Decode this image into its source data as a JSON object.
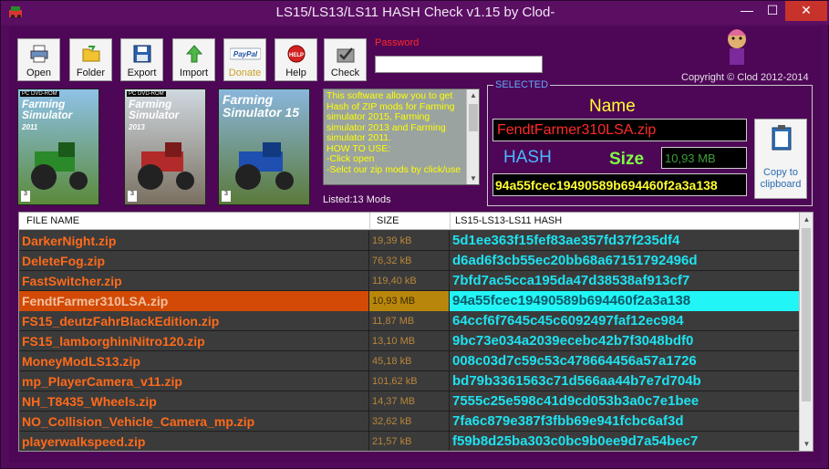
{
  "window": {
    "title": "LS15/LS13/LS11 HASH Check v1.15 by Clod-",
    "minimize_glyph": "—",
    "maximize_glyph": "☐",
    "close_glyph": "✕"
  },
  "toolbar": {
    "buttons": [
      {
        "label": "Open",
        "icon": "printer-icon"
      },
      {
        "label": "Folder",
        "icon": "folder-icon"
      },
      {
        "label": "Export",
        "icon": "floppy-icon"
      },
      {
        "label": "Import",
        "icon": "import-arrow-icon"
      },
      {
        "label": "Donate",
        "icon": "paypal-icon"
      },
      {
        "label": "Help",
        "icon": "help-icon"
      },
      {
        "label": "Check",
        "icon": "check-icon"
      }
    ],
    "paypal_text": "PayPal",
    "help_text": "HELP"
  },
  "password": {
    "label": "Password",
    "value": ""
  },
  "copyright": "Copyright © Clod 2012-2014",
  "covers": [
    {
      "platform": "PC DVD-ROM",
      "title": "Farming Simulator",
      "year": "2011",
      "pegi": "3"
    },
    {
      "platform": "PC DVD-ROM",
      "title": "Farming Simulator",
      "year": "2013",
      "pegi": "3"
    },
    {
      "platform": "",
      "title": "Farming Simulator 15",
      "year": "",
      "pegi": "3"
    }
  ],
  "info_text": "This software allow you to get Hash of ZIP mods for Farming simulator 2015, Farming simulator 2013 and Farming simulator 2011.\nHOW TO USE:\n-Click open\n-Selct our zip mods by click/use",
  "listed": "Listed:13 Mods",
  "selected": {
    "legend": "SELECTED",
    "name_label": "Name",
    "name_value": "FendtFarmer310LSA.zip",
    "hash_label": "HASH",
    "size_label": "Size",
    "size_value": "10,93 MB",
    "hash_value": "94a55fcec19490589b694460f2a3a138",
    "copy_label": "Copy to clipboard"
  },
  "table": {
    "columns": [
      "FILE NAME",
      "SIZE",
      "LS15-LS13-LS11 HASH"
    ],
    "selected_index": 3,
    "rows": [
      {
        "name": "DarkerNight.zip",
        "size": "19,39 kB",
        "hash": "5d1ee363f15fef83ae357fd37f235df4"
      },
      {
        "name": "DeleteFog.zip",
        "size": "76,32 kB",
        "hash": "d6ad6f3cb55ec20bb68a67151792496d"
      },
      {
        "name": "FastSwitcher.zip",
        "size": "119,40 kB",
        "hash": "7bfd7ac5cca195da47d38538af913cf7"
      },
      {
        "name": "FendtFarmer310LSA.zip",
        "size": "10,93 MB",
        "hash": "94a55fcec19490589b694460f2a3a138"
      },
      {
        "name": "FS15_deutzFahrBlackEdition.zip",
        "size": "11,87 MB",
        "hash": "64ccf6f7645c45c6092497faf12ec984"
      },
      {
        "name": "FS15_lamborghiniNitro120.zip",
        "size": "13,10 MB",
        "hash": "9bc73e034a2039ecebc42b7f3048bdf0"
      },
      {
        "name": "MoneyModLS13.zip",
        "size": "45,18 kB",
        "hash": "008c03d7c59c53c478664456a57a1726"
      },
      {
        "name": "mp_PlayerCamera_v11.zip",
        "size": "101,62 kB",
        "hash": "bd79b3361563c71d566aa44b7e7d704b"
      },
      {
        "name": "NH_T8435_Wheels.zip",
        "size": "14,37 MB",
        "hash": "7555c25e598c41d9cd053b3a0c7e1bee"
      },
      {
        "name": "NO_Collision_Vehicle_Camera_mp.zip",
        "size": "32,62 kB",
        "hash": "7fa6c879e387f3fbb69e941fcbc6af3d"
      },
      {
        "name": "playerwalkspeed.zip",
        "size": "21,57 kB",
        "hash": "f59b8d25ba303c0bc9b0ee9d7a54bec7"
      }
    ]
  }
}
